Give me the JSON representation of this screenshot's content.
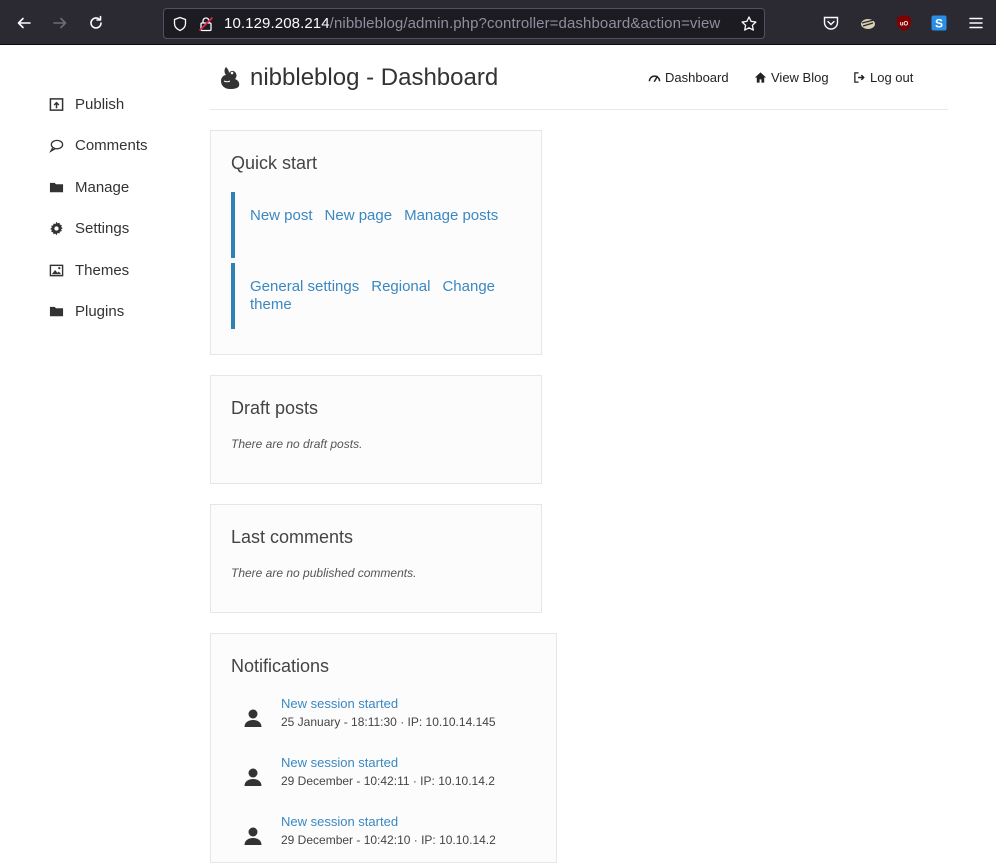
{
  "browser": {
    "url_host": "10.129.208.214",
    "url_path": "/nibbleblog/admin.php?controller=dashboard&action=view"
  },
  "sidebar": {
    "items": [
      {
        "label": "Publish",
        "icon": "publish-icon"
      },
      {
        "label": "Comments",
        "icon": "comment-icon"
      },
      {
        "label": "Manage",
        "icon": "folder-icon"
      },
      {
        "label": "Settings",
        "icon": "gear-icon"
      },
      {
        "label": "Themes",
        "icon": "image-icon"
      },
      {
        "label": "Plugins",
        "icon": "folder-icon"
      }
    ]
  },
  "header": {
    "title": "nibbleblog - Dashboard",
    "nav": [
      {
        "label": "Dashboard",
        "icon": "dashboard-icon"
      },
      {
        "label": "View Blog",
        "icon": "home-icon"
      },
      {
        "label": "Log out",
        "icon": "logout-icon"
      }
    ]
  },
  "quick_start": {
    "title": "Quick start",
    "group1": [
      "New post",
      "New page",
      "Manage posts"
    ],
    "group2": [
      "General settings",
      "Regional",
      "Change theme"
    ]
  },
  "draft_posts": {
    "title": "Draft posts",
    "empty": "There are no draft posts."
  },
  "last_comments": {
    "title": "Last comments",
    "empty": "There are no published comments."
  },
  "notifications": {
    "title": "Notifications",
    "items": [
      {
        "title": "New session started",
        "meta": "25 January - 18:11:30 · IP: 10.10.14.145"
      },
      {
        "title": "New session started",
        "meta": "29 December - 10:42:11 · IP: 10.10.14.2"
      },
      {
        "title": "New session started",
        "meta": "29 December - 10:42:10 · IP: 10.10.14.2"
      }
    ]
  },
  "colors": {
    "link": "#3a88c1",
    "accent_bar": "#2e82b3",
    "chrome_bg": "#2b2a33"
  }
}
